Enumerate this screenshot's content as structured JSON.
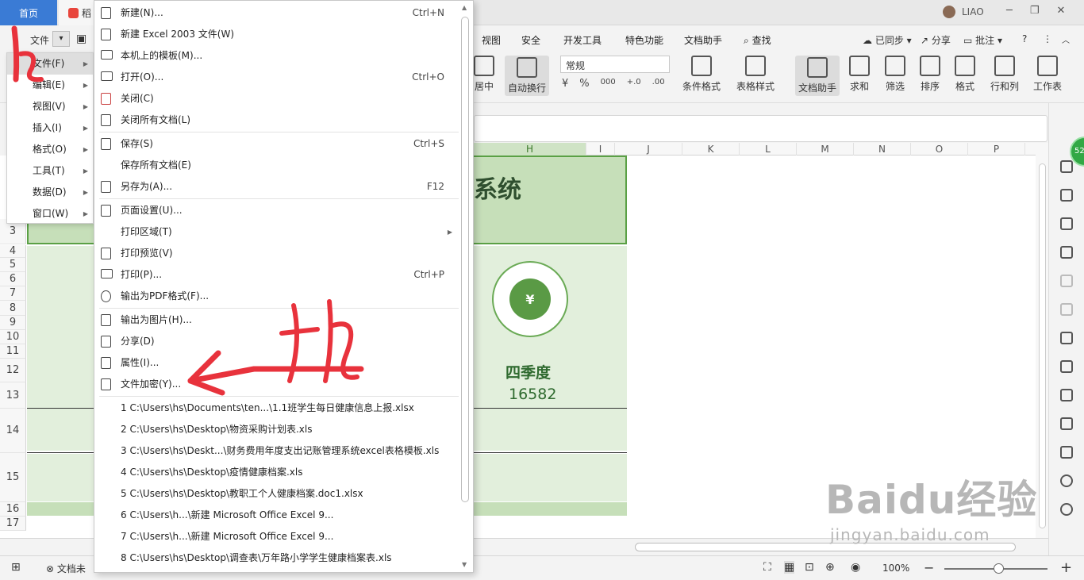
{
  "titlebar": {
    "home_tab": "首页",
    "doc_tab": "稻",
    "user_name": "LIAO",
    "window_controls": [
      "─",
      "❐",
      "✕"
    ]
  },
  "tabs": {
    "items": [
      "视图",
      "安全",
      "开发工具",
      "特色功能",
      "文档助手"
    ],
    "search": "查找",
    "sync": "已同步",
    "share": "分享",
    "comment": "批注",
    "help": "?",
    "more": "⋮"
  },
  "quick": {
    "file_label": "文件"
  },
  "ribbon": {
    "merge_center": "居中",
    "auto_wrap": "自动换行",
    "number_format": "常规",
    "num_buttons": [
      "¥",
      "%",
      "000",
      "+.0",
      ".00"
    ],
    "cond_format": "条件格式",
    "table_style": "表格样式",
    "doc_helper": "文档助手",
    "sum": "求和",
    "filter": "筛选",
    "sort": "排序",
    "format": "格式",
    "rows_cols": "行和列",
    "worksheet": "工作表"
  },
  "sheet": {
    "columns": [
      "H",
      "I",
      "J",
      "K",
      "L",
      "M",
      "N",
      "O",
      "P"
    ],
    "rows": [
      "3",
      "4",
      "5",
      "6",
      "7",
      "8",
      "9",
      "10",
      "11",
      "12",
      "13",
      "14",
      "15",
      "16",
      "17"
    ],
    "banner_title": "系统",
    "quarter_label": "四季度",
    "quarter_value": "16582"
  },
  "left_menu": [
    {
      "label": "文件(F)",
      "active": true
    },
    {
      "label": "编辑(E)",
      "active": false
    },
    {
      "label": "视图(V)",
      "active": false
    },
    {
      "label": "插入(I)",
      "active": false
    },
    {
      "label": "格式(O)",
      "active": false
    },
    {
      "label": "工具(T)",
      "active": false
    },
    {
      "label": "数据(D)",
      "active": false
    },
    {
      "label": "窗口(W)",
      "active": false
    }
  ],
  "file_menu": {
    "new": {
      "label": "新建(N)...",
      "shortcut": "Ctrl+N"
    },
    "new_2003": {
      "label": "新建 Excel 2003 文件(W)"
    },
    "templates": {
      "label": "本机上的模板(M)..."
    },
    "open": {
      "label": "打开(O)...",
      "shortcut": "Ctrl+O"
    },
    "close": {
      "label": "关闭(C)"
    },
    "close_all": {
      "label": "关闭所有文档(L)"
    },
    "save": {
      "label": "保存(S)",
      "shortcut": "Ctrl+S"
    },
    "save_all": {
      "label": "保存所有文档(E)"
    },
    "save_as": {
      "label": "另存为(A)...",
      "shortcut": "F12"
    },
    "page_setup": {
      "label": "页面设置(U)..."
    },
    "print_area": {
      "label": "打印区域(T)"
    },
    "print_preview": {
      "label": "打印预览(V)"
    },
    "print": {
      "label": "打印(P)...",
      "shortcut": "Ctrl+P"
    },
    "export_pdf": {
      "label": "输出为PDF格式(F)..."
    },
    "export_image": {
      "label": "输出为图片(H)..."
    },
    "share": {
      "label": "分享(D)"
    },
    "properties": {
      "label": "属性(I)..."
    },
    "encrypt": {
      "label": "文件加密(Y)..."
    },
    "recent": [
      "1 C:\\Users\\hs\\Documents\\ten...\\1.1班学生每日健康信息上报.xlsx",
      "2 C:\\Users\\hs\\Desktop\\物资采购计划表.xls",
      "3 C:\\Users\\hs\\Deskt...\\财务费用年度支出记账管理系统excel表格模板.xls",
      "4 C:\\Users\\hs\\Desktop\\疫情健康档案.xls",
      "5 C:\\Users\\hs\\Desktop\\教职工个人健康档案.doc1.xlsx",
      "6 C:\\Users\\h...\\新建 Microsoft Office Excel 9...",
      "7 C:\\Users\\h...\\新建 Microsoft Office Excel 9...",
      "8 C:\\Users\\hs\\Desktop\\调查表\\万年路小学学生健康档案表.xls"
    ]
  },
  "sheet_bar": {
    "sheet_tab": "文档未"
  },
  "statusbar": {
    "zoom": "100%",
    "zoom_level": 1.0
  },
  "sidebar": {
    "badge": "52"
  },
  "annotations": {
    "step1": "1",
    "step2": "选"
  },
  "watermark": {
    "main": "Baidu经验",
    "sub": "jingyan.baidu.com"
  },
  "colors": {
    "accent_green": "#5aa045",
    "banner_fill": "#c6dfb9",
    "card_fill": "#e2efdc",
    "home_tab": "#3a7bd5",
    "annotation_red": "#e8323c"
  }
}
